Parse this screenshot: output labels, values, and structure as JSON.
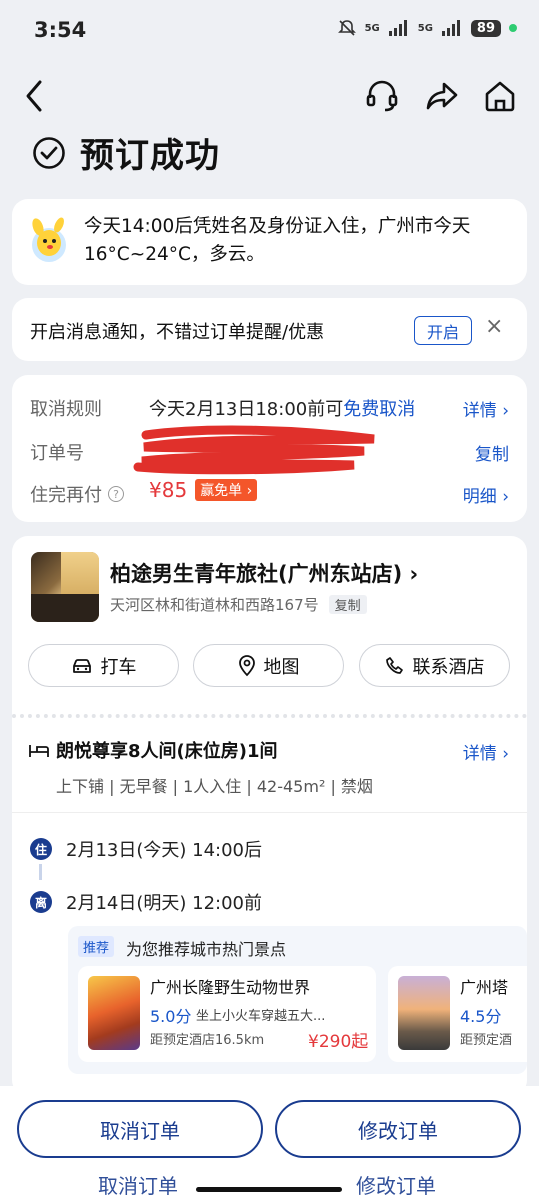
{
  "status_bar": {
    "time": "3:54",
    "network_a": "5G",
    "network_b": "5G",
    "battery": "89"
  },
  "header": {
    "title": "预订成功"
  },
  "tip": {
    "text": "今天14:00后凭姓名及身份证入住，广州市今天16°C~24°C，多云。"
  },
  "notify": {
    "text": "开启消息通知，不错过订单提醒/优惠",
    "button": "开启",
    "close": "×"
  },
  "rules": {
    "cancel_label": "取消规则",
    "cancel_value": "今天2月13日18:00前可",
    "cancel_free": "免费取消",
    "cancel_link": "详情",
    "order_label": "订单号",
    "order_link": "复制",
    "pay_label": "住完再付",
    "pay_info_icon": "?",
    "pay_price": "¥85",
    "pay_badge": "赢免单",
    "pay_link": "明细"
  },
  "hotel": {
    "name": "柏途男生青年旅社(广州东站店)",
    "address": "天河区林和街道林和西路167号",
    "copy": "复制",
    "actions": {
      "taxi": "打车",
      "map": "地图",
      "contact": "联系酒店"
    }
  },
  "room": {
    "title": "朗悦尊享8人间(床位房)1间",
    "detail_link": "详情",
    "tags": "上下铺 | 无早餐 | 1人入住 | 42-45m² | 禁烟"
  },
  "stay": {
    "checkin_badge": "住",
    "checkin": "2月13日(今天) 14:00后",
    "checkout_badge": "离",
    "checkout": "2月14日(明天) 12:00前"
  },
  "recommend": {
    "tag": "推荐",
    "heading": "为您推荐城市热门景点",
    "items": [
      {
        "name": "广州长隆野生动物世界",
        "score": "5.0分",
        "desc": "坐上小火车穿越五大...",
        "distance": "距预定酒店16.5km",
        "price": "¥290起"
      },
      {
        "name": "广州塔",
        "score": "4.5分",
        "desc": "",
        "distance": "距预定酒",
        "price": ""
      }
    ]
  },
  "footer": {
    "cancel": "取消订单",
    "modify": "修改订单"
  },
  "colors": {
    "accent": "#1a56c9",
    "navy": "#1a3c8f",
    "price": "#e4393c",
    "background": "#eef0f4"
  }
}
